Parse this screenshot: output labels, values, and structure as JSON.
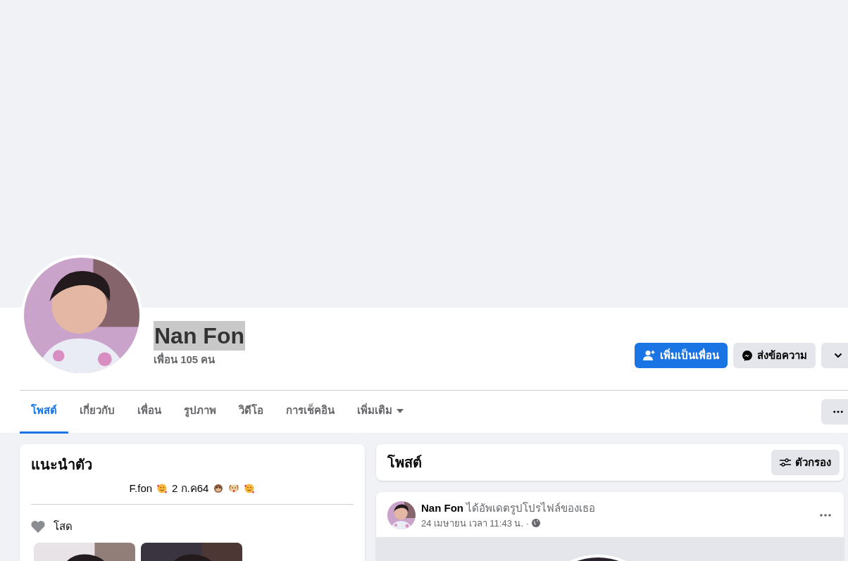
{
  "profile": {
    "name": "Nan Fon",
    "name_highlighted": true,
    "friends": "เพื่อน 105 คน",
    "buttons": [
      {
        "kind": "add-friend",
        "label": "เพิ่มเป็นเพื่อน"
      },
      {
        "kind": "message",
        "label": "ส่งข้อความ"
      },
      {
        "kind": "more"
      }
    ]
  },
  "tabs": [
    {
      "label": "โพสต์",
      "selected": true,
      "dropdown": false
    },
    {
      "label": "เกี่ยวกับ",
      "selected": false,
      "dropdown": false
    },
    {
      "label": "เพื่อน",
      "selected": false,
      "dropdown": false
    },
    {
      "label": "รูปภาพ",
      "selected": false,
      "dropdown": false
    },
    {
      "label": "วิดีโอ",
      "selected": false,
      "dropdown": false
    },
    {
      "label": "การเช็คอิน",
      "selected": false,
      "dropdown": false
    },
    {
      "label": "เพิ่มเติม",
      "selected": false,
      "dropdown": true
    }
  ],
  "intro": {
    "title": "แนะนำตัว",
    "bio": [
      {
        "kind": "text",
        "text": "F.fon"
      },
      {
        "kind": "hearts"
      },
      {
        "kind": "text",
        "text": "2 ก.ค64"
      },
      {
        "kind": "monkey"
      },
      {
        "kind": "dog"
      },
      {
        "kind": "hearts"
      }
    ],
    "details": [
      {
        "kind": "relationship",
        "text": "โสด"
      }
    ]
  },
  "posts": {
    "title": "โพสต์",
    "filter_label": "ตัวกรอง",
    "items": [
      {
        "author": "Nan Fon",
        "action": "ได้อัพเดตรูปโปรไฟล์ของเธอ",
        "time": "24 เมษายน เวลา 11:43 น. ·"
      }
    ]
  }
}
